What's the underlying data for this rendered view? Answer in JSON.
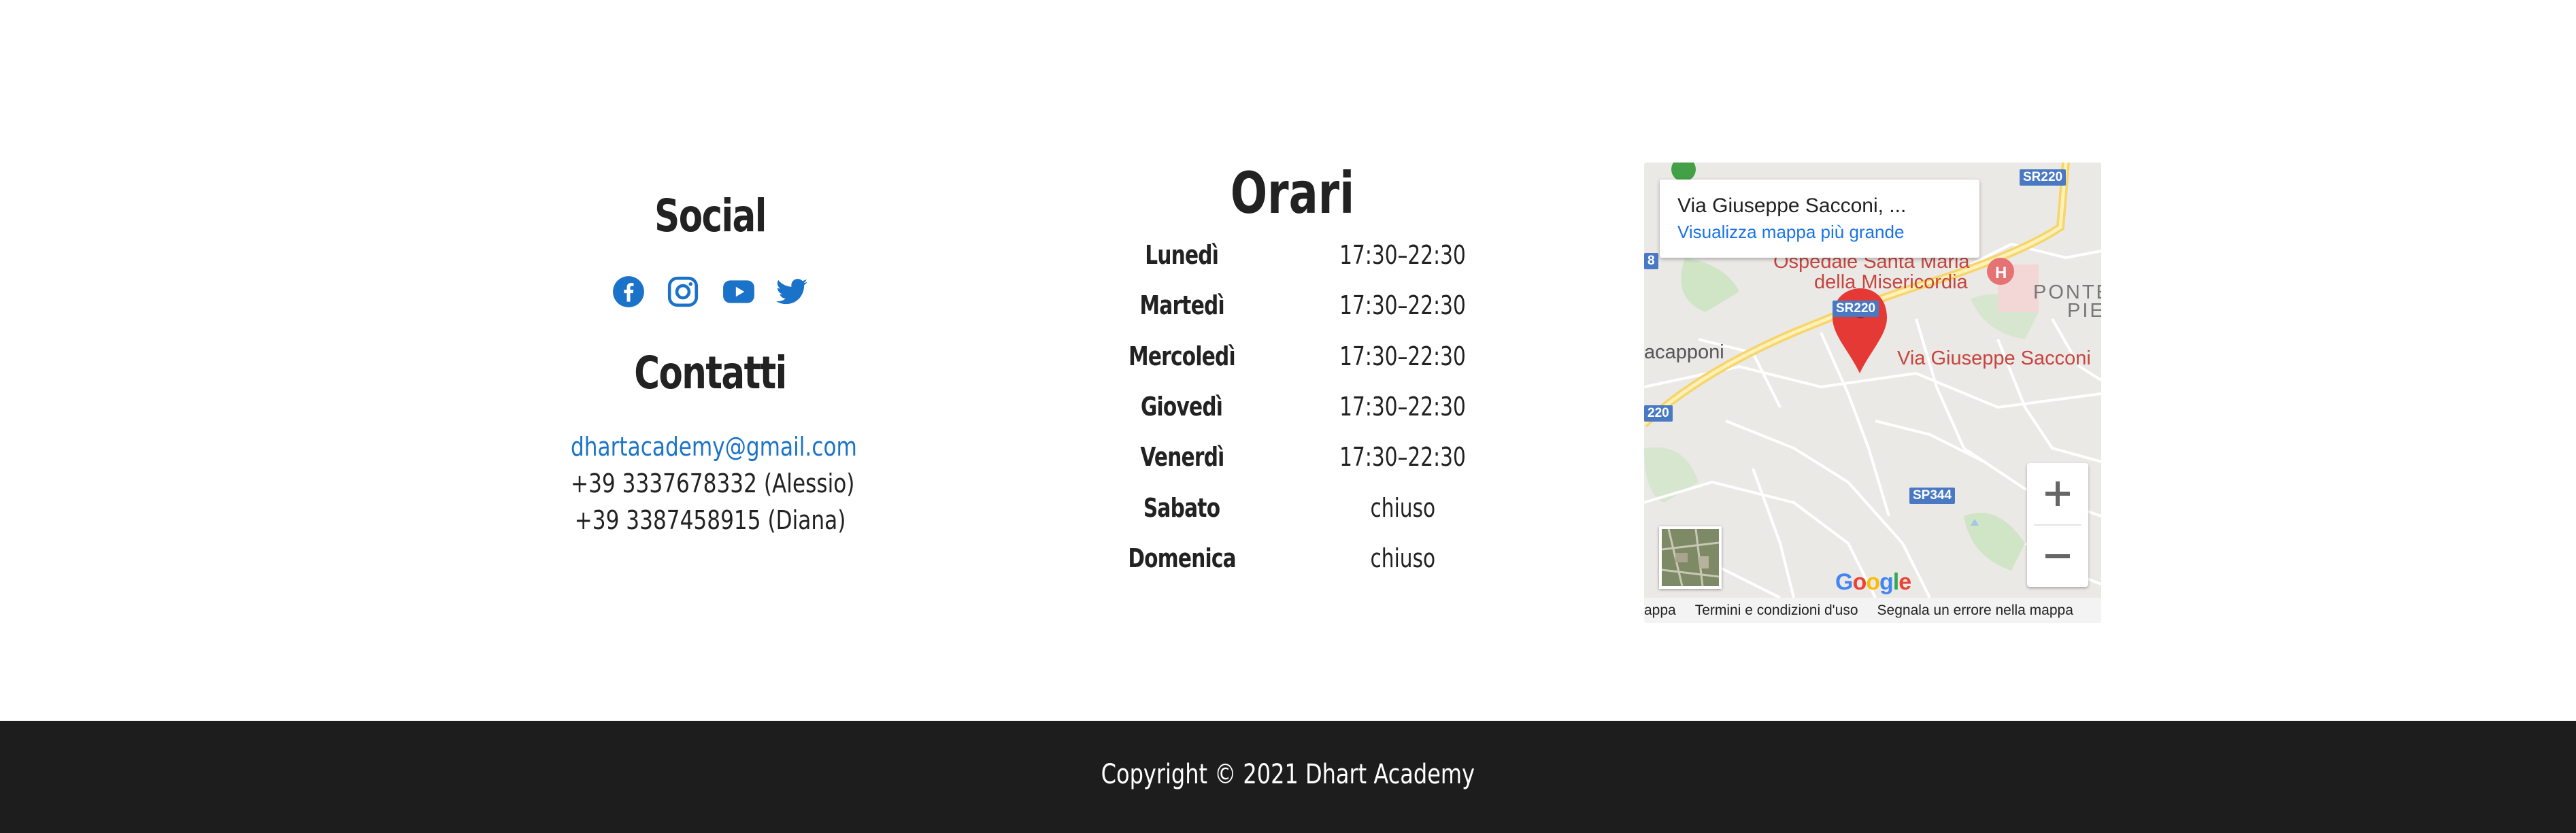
{
  "social": {
    "heading": "Social",
    "icons": [
      "facebook-icon",
      "instagram-icon",
      "youtube-icon",
      "twitter-icon"
    ],
    "icon_color": "#1a73c8"
  },
  "contacts": {
    "heading": "Contatti",
    "email": "dhartacademy@gmail.com",
    "phone_1": "+39 3337678332 (Alessio)",
    "phone_2": "+39 3387458915 (Diana)"
  },
  "hours": {
    "heading": "Orari",
    "rows": [
      {
        "day": "Lunedì",
        "time": "17:30–22:30"
      },
      {
        "day": "Martedì",
        "time": "17:30–22:30"
      },
      {
        "day": "Mercoledì",
        "time": "17:30–22:30"
      },
      {
        "day": "Giovedì",
        "time": "17:30–22:30"
      },
      {
        "day": "Venerdì",
        "time": "17:30–22:30"
      },
      {
        "day": "Sabato",
        "time": "chiuso"
      },
      {
        "day": "Domenica",
        "time": "chiuso"
      }
    ]
  },
  "map": {
    "card_title": "Via Giuseppe Sacconi, ...",
    "card_link": "Visualizza mappa più grande",
    "labels": {
      "hospital": "Ospedale Santa Maria",
      "hospital_2": "della Misericordia",
      "place_left": "acapponi",
      "place_right": "PONTE",
      "place_right_2": "PIE",
      "pin_label": "Via Giuseppe Sacconi"
    },
    "shields": {
      "top": "SR220",
      "mid": "SR220",
      "left": "220",
      "left_top": "8",
      "bottom": "SP344"
    },
    "logo": "Google",
    "footer": {
      "data": "appa",
      "terms": "Termini e condizioni d'uso",
      "report": "Segnala un errore nella mappa"
    }
  },
  "footer": {
    "copyright": "Copyright © 2021 Dhart Academy"
  },
  "colors": {
    "accent": "#1a73c8",
    "footer_bg": "#1d1d1d",
    "pin": "#e53935"
  }
}
